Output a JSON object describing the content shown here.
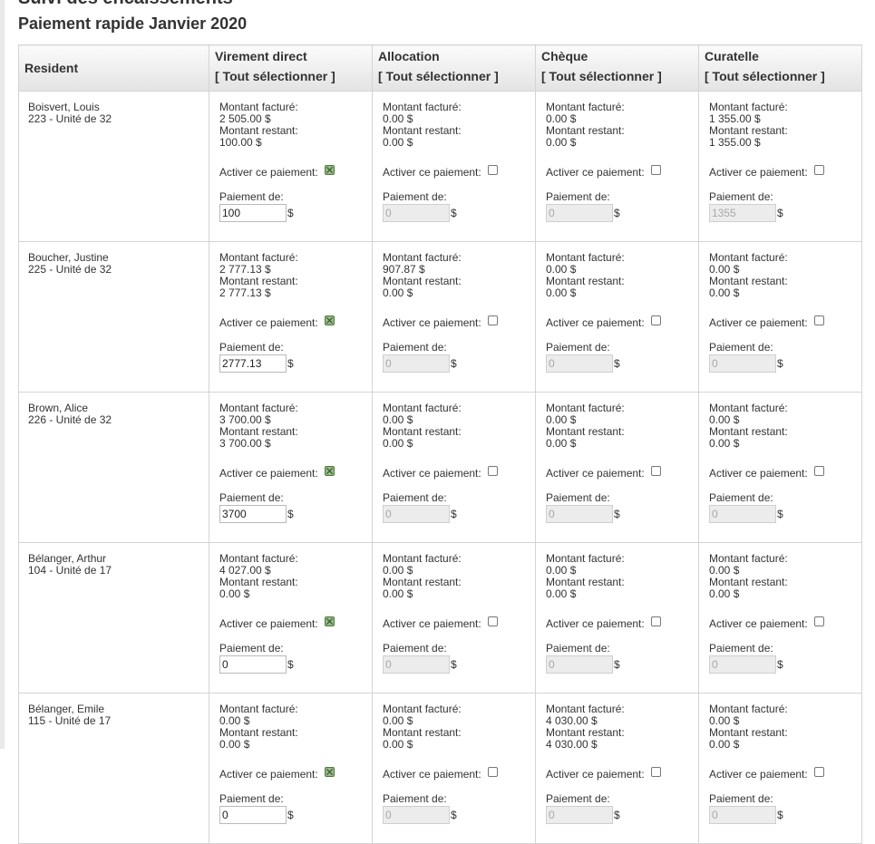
{
  "page": {
    "title": "Suivi des encaissements",
    "subtitle": "Paiement rapide Janvier 2020"
  },
  "table": {
    "resident_header": "Resident",
    "select_all_label": "[ Tout sélectionner ]",
    "payment_methods": [
      "Virement direct",
      "Allocation",
      "Chèque",
      "Curatelle"
    ],
    "labels": {
      "billed": "Montant facturé:",
      "remaining": "Montant restant:",
      "activate": "Activer ce paiement:",
      "payment_from": "Paiement de:",
      "currency": "$"
    },
    "rows": [
      {
        "name": "Boisvert, Louis",
        "unit": "223 - Unité de 32",
        "payments": [
          {
            "billed": "2 505.00 $",
            "remaining": "100.00 $",
            "active": true,
            "value": "100"
          },
          {
            "billed": "0.00 $",
            "remaining": "0.00 $",
            "active": false,
            "value": "0"
          },
          {
            "billed": "0.00 $",
            "remaining": "0.00 $",
            "active": false,
            "value": "0"
          },
          {
            "billed": "1 355.00 $",
            "remaining": "1 355.00 $",
            "active": false,
            "value": "1355"
          }
        ]
      },
      {
        "name": "Boucher, Justine",
        "unit": "225 - Unité de 32",
        "payments": [
          {
            "billed": "2 777.13 $",
            "remaining": "2 777.13 $",
            "active": true,
            "value": "2777.13"
          },
          {
            "billed": "907.87 $",
            "remaining": "0.00 $",
            "active": false,
            "value": "0"
          },
          {
            "billed": "0.00 $",
            "remaining": "0.00 $",
            "active": false,
            "value": "0"
          },
          {
            "billed": "0.00 $",
            "remaining": "0.00 $",
            "active": false,
            "value": "0"
          }
        ]
      },
      {
        "name": "Brown, Alice",
        "unit": "226 - Unité de 32",
        "payments": [
          {
            "billed": "3 700.00 $",
            "remaining": "3 700.00 $",
            "active": true,
            "value": "3700"
          },
          {
            "billed": "0.00 $",
            "remaining": "0.00 $",
            "active": false,
            "value": "0"
          },
          {
            "billed": "0.00 $",
            "remaining": "0.00 $",
            "active": false,
            "value": "0"
          },
          {
            "billed": "0.00 $",
            "remaining": "0.00 $",
            "active": false,
            "value": "0"
          }
        ]
      },
      {
        "name": "Bélanger, Arthur",
        "unit": "104 - Unité de 17",
        "payments": [
          {
            "billed": "4 027.00 $",
            "remaining": "0.00 $",
            "active": true,
            "value": "0"
          },
          {
            "billed": "0.00 $",
            "remaining": "0.00 $",
            "active": false,
            "value": "0"
          },
          {
            "billed": "0.00 $",
            "remaining": "0.00 $",
            "active": false,
            "value": "0"
          },
          {
            "billed": "0.00 $",
            "remaining": "0.00 $",
            "active": false,
            "value": "0"
          }
        ]
      },
      {
        "name": "Bélanger, Emile",
        "unit": "115 - Unité de 17",
        "payments": [
          {
            "billed": "0.00 $",
            "remaining": "0.00 $",
            "active": true,
            "value": "0"
          },
          {
            "billed": "0.00 $",
            "remaining": "0.00 $",
            "active": false,
            "value": "0"
          },
          {
            "billed": "4 030.00 $",
            "remaining": "4 030.00 $",
            "active": false,
            "value": "0"
          },
          {
            "billed": "0.00 $",
            "remaining": "0.00 $",
            "active": false,
            "value": "0"
          }
        ]
      }
    ]
  }
}
